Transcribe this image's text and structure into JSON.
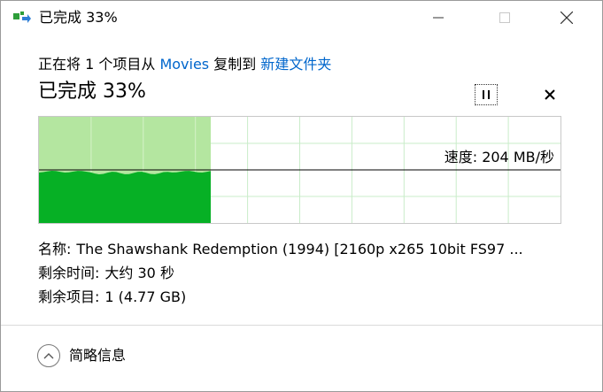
{
  "window": {
    "title": "已完成 33%",
    "controls": {
      "minimize": "minimize",
      "maximize": "maximize",
      "close": "close"
    }
  },
  "copy": {
    "prefix": "正在将 1 个项目从 ",
    "source": "Movies",
    "middle": " 复制到 ",
    "destination": "新建文件夹"
  },
  "status": {
    "text": "已完成 33%",
    "progress_percent": 33
  },
  "graph": {
    "speed_label": "速度: 204 MB/秒",
    "colors": {
      "fill_light": "#b4e6a0",
      "fill_dark": "#06b025",
      "grid": "#c9ecc9",
      "border": "#c8c8c8",
      "speed_line": "#000000"
    }
  },
  "details": {
    "name_label": "名称:",
    "name_value": "The Shawshank Redemption (1994)  [2160p x265 10bit FS97 ...",
    "time_label": "剩余时间:",
    "time_value": "大约 30 秒",
    "items_label": "剩余项目:",
    "items_value": "1 (4.77 GB)"
  },
  "footer": {
    "toggle_label": "简略信息",
    "toggle_icon": "chevron-up-icon"
  },
  "icons": {
    "app": "copy-files-icon",
    "pause": "pause-icon",
    "cancel": "close-icon"
  }
}
